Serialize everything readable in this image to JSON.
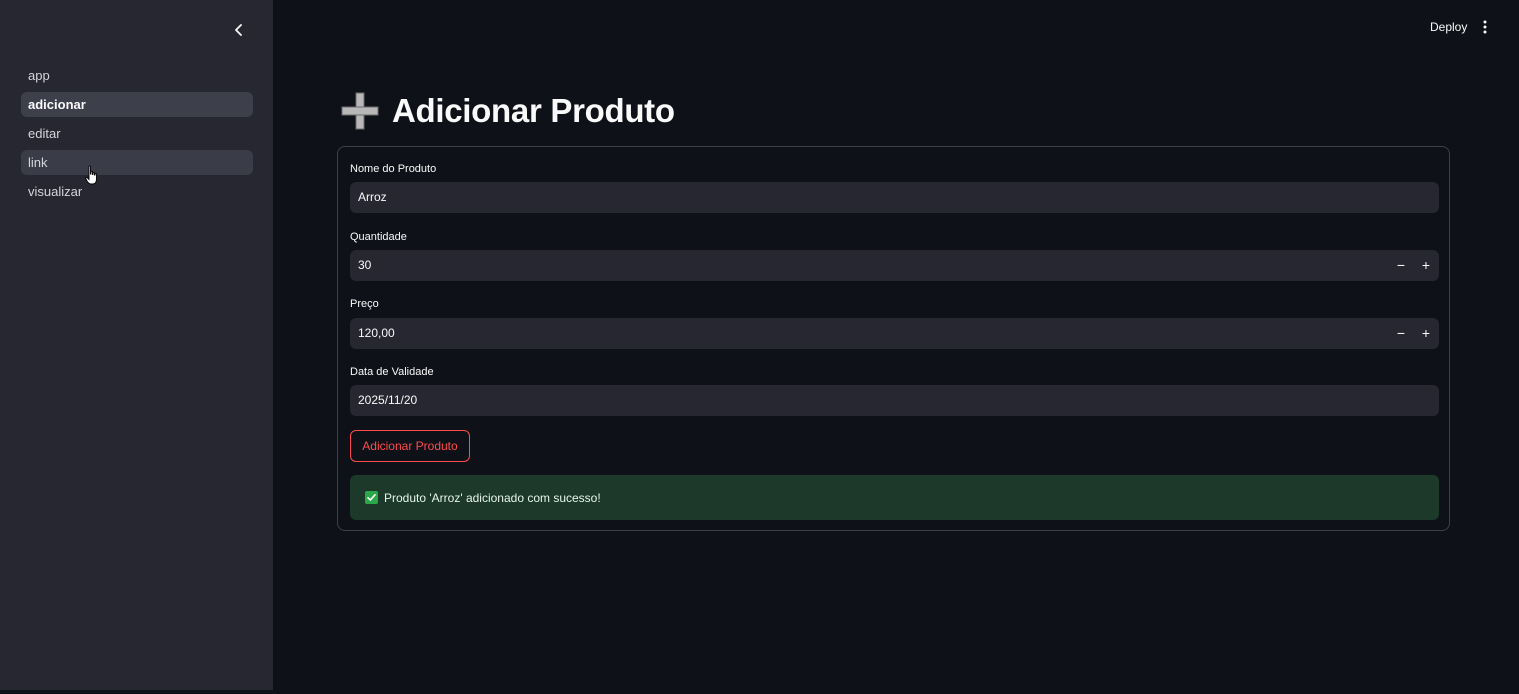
{
  "header": {
    "deploy_label": "Deploy",
    "menu_icon": "kebab-menu-icon"
  },
  "sidebar": {
    "collapse_icon": "chevron-left-icon",
    "items": [
      {
        "label": "app",
        "state": "normal"
      },
      {
        "label": "adicionar",
        "state": "active"
      },
      {
        "label": "editar",
        "state": "normal"
      },
      {
        "label": "link",
        "state": "hover"
      },
      {
        "label": "visualizar",
        "state": "normal"
      }
    ]
  },
  "main": {
    "title_icon": "plus-icon",
    "title": "Adicionar Produto",
    "form": {
      "nome": {
        "label": "Nome do Produto",
        "value": "Arroz"
      },
      "quantidade": {
        "label": "Quantidade",
        "value": "30",
        "minus": "−",
        "plus": "+"
      },
      "preco": {
        "label": "Preço",
        "value": "120,00",
        "minus": "−",
        "plus": "+"
      },
      "validade": {
        "label": "Data de Validade",
        "value": "2025/11/20"
      },
      "submit_label": "Adicionar Produto"
    },
    "success": {
      "icon": "check-icon",
      "message": "Produto 'Arroz' adicionado com sucesso!"
    }
  },
  "colors": {
    "background": "#0e1117",
    "sidebar": "#262730",
    "input": "#262730",
    "accent": "#ff4b4b",
    "success_bg": "#1c3929",
    "success_check": "#2ba84a"
  }
}
